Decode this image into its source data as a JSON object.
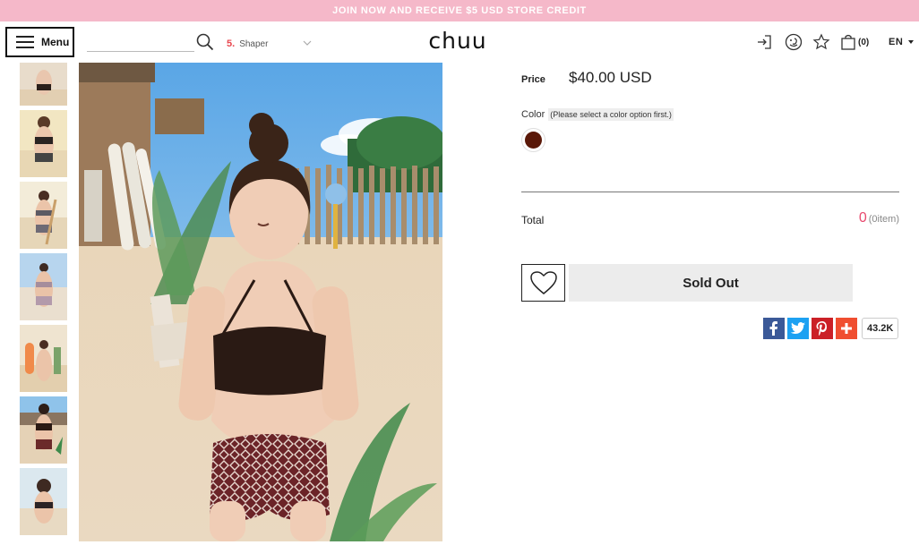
{
  "promo": {
    "text": "JOIN NOW AND RECEIVE $5 USD STORE CREDIT",
    "bg": "#f5b8c9"
  },
  "header": {
    "menu_label": "Menu",
    "search": {
      "value": "",
      "placeholder": ""
    },
    "trending": {
      "rank": "5.",
      "term": "Shaper"
    },
    "logo": "chuu",
    "icons": [
      "login-icon",
      "face-icon",
      "star-icon",
      "bag-icon"
    ],
    "cart_count": "(0)",
    "language": "EN"
  },
  "product": {
    "price_label": "Price",
    "price_value": "$40.00 USD",
    "color_label": "Color",
    "color_hint": "(Please select a color option first.)",
    "swatch_color": "#5a1808",
    "total_label": "Total",
    "total_count": "0",
    "total_items": "(0item)",
    "sold_out_label": "Sold Out",
    "share_count": "43.2K"
  },
  "share": [
    {
      "name": "facebook",
      "glyph": "f",
      "color": "#3b5998"
    },
    {
      "name": "twitter",
      "glyph": "t",
      "color": "#1da1f2"
    },
    {
      "name": "pinterest",
      "glyph": "P",
      "color": "#cb2027"
    },
    {
      "name": "more",
      "glyph": "+",
      "color": "#f04e30"
    }
  ],
  "accent_pink": "#e84a6e"
}
